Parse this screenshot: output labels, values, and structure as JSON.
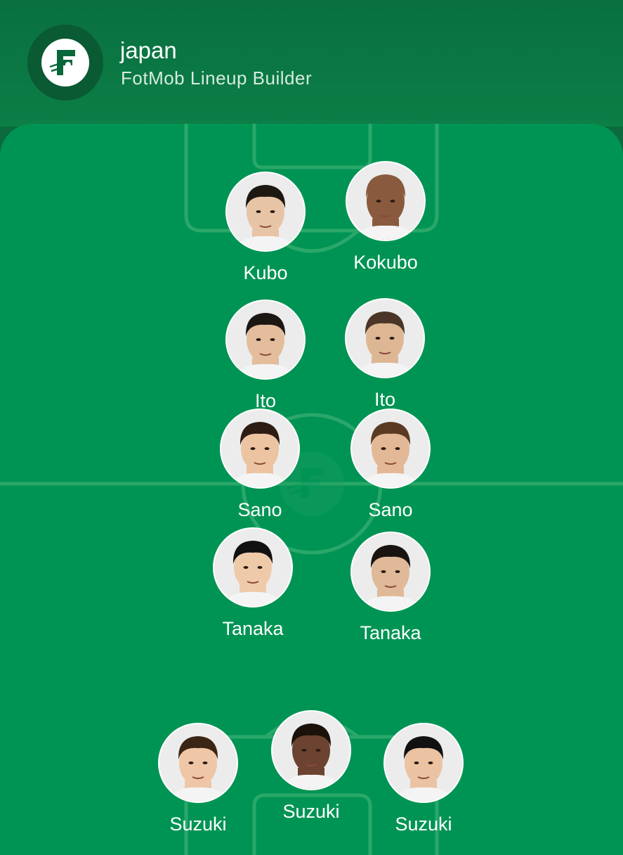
{
  "header": {
    "team_name": "japan",
    "subtitle": "FotMob Lineup Builder",
    "logo_icon": "fotmob-logo-icon"
  },
  "colors": {
    "header_bg": "#097040",
    "pitch_bg": "#009454",
    "pitch_lines": "#2ba86b",
    "text": "#ffffff"
  },
  "lineup": [
    {
      "name": "Kubo",
      "skin": "#e8c4a6",
      "hair": "#1e1812"
    },
    {
      "name": "Kokubo",
      "skin": "#8a5a3e",
      "hair": "#8a5a3e"
    },
    {
      "name": "Ito",
      "skin": "#e3bd9c",
      "hair": "#1d1713"
    },
    {
      "name": "Ito",
      "skin": "#ddb794",
      "hair": "#4a3526"
    },
    {
      "name": "Sano",
      "skin": "#ecc4a2",
      "hair": "#2c1c12"
    },
    {
      "name": "Sano",
      "skin": "#e3b896",
      "hair": "#5a3a22"
    },
    {
      "name": "Tanaka",
      "skin": "#efcaa9",
      "hair": "#111111"
    },
    {
      "name": "Tanaka",
      "skin": "#e0b998",
      "hair": "#1a1410"
    },
    {
      "name": "Suzuki",
      "skin": "#efc6a6",
      "hair": "#3b2514"
    },
    {
      "name": "Suzuki",
      "skin": "#6b4330",
      "hair": "#1a110b"
    },
    {
      "name": "Suzuki",
      "skin": "#ebc3a2",
      "hair": "#111111"
    }
  ]
}
